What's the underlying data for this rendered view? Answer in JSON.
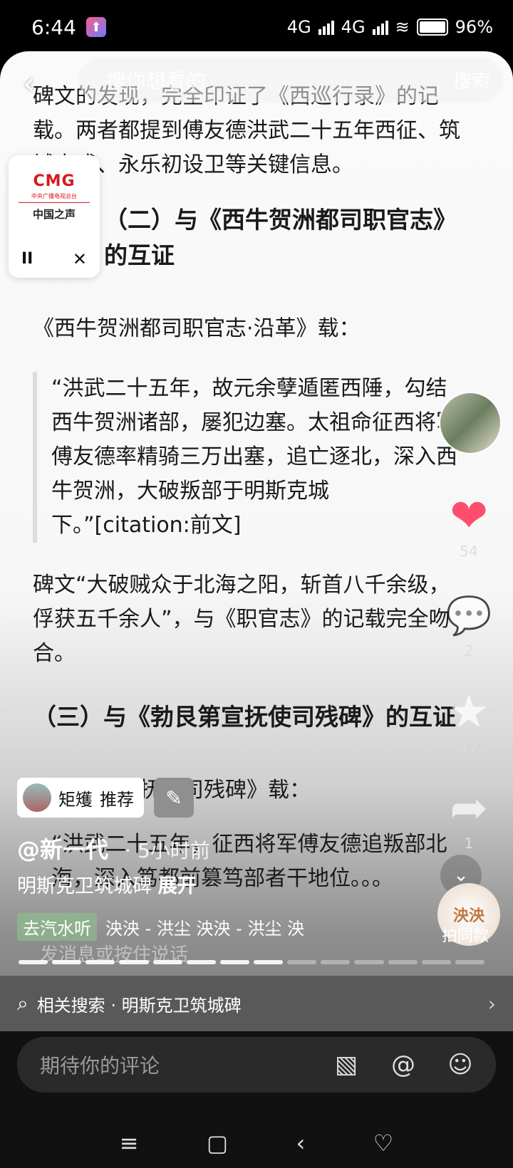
{
  "status": {
    "time": "6:44",
    "network1": "4G",
    "network2": "4G",
    "battery": "96%"
  },
  "search": {
    "placeholder": "搜你想看的",
    "button": "搜索"
  },
  "article": {
    "p1": "碑文的发现，完全印证了《西巡行录》的记载。两者都提到傅友德洪武二十五年西征、筑城屯戍、永乐初设卫等关键信息。",
    "h2": "（二）与《西牛贺洲都司职官志》的互证",
    "p2": "《西牛贺洲都司职官志·沿革》载：",
    "quote1": "“洪武二十五年，故元余孽遁匿西陲，勾结西牛贺洲诸部，屡犯边塞。太祖命征西将军傅友德率精骑三万出塞，追亡逐北，深入西牛贺洲，大破叛部于明斯克城下。”[citation:前文]",
    "p3": "碑文“大破贼众于北海之阳，斩首八千余级，俘获五千余人”，与《职官志》的记载完全吻合。",
    "h3": "（三）与《勃艮第宣抚使司残碑》的互证",
    "p4": "《勃艮第宣抚使司残碑》载：",
    "quote2": "“洪武二十五年，征西将军傅友德追叛部北海，深入笃都前篡笃部者干地位。。。"
  },
  "mini_player": {
    "logo": "CMG",
    "sub": "中央广播电视总台",
    "name": "中国之声",
    "pause": "II",
    "close": "✕"
  },
  "side": {
    "like_count": "54",
    "comment_count": "2",
    "star_count": "17",
    "share_count": "1"
  },
  "recommend": {
    "name": "矩矱",
    "label": "推荐"
  },
  "post": {
    "author": "@新一代",
    "time": "· 5小时前",
    "title": "明斯克卫筑城碑",
    "expand": "展开"
  },
  "music": {
    "tag": "去汽水听",
    "track": "泱泱 - 洪尘   泱泱 - 洪尘   泱"
  },
  "same_style": {
    "badge": "泱泱",
    "label": "拍同款"
  },
  "ghost_input": "发消息或按住说话",
  "progress": {
    "segments": 14,
    "done": 8
  },
  "related": {
    "text": "相关搜索 · 明斯克卫筑城碑"
  },
  "comment": {
    "placeholder": "期待你的评论"
  },
  "colors": {
    "like": "#ff4d6d",
    "accent": "#d7191d"
  }
}
